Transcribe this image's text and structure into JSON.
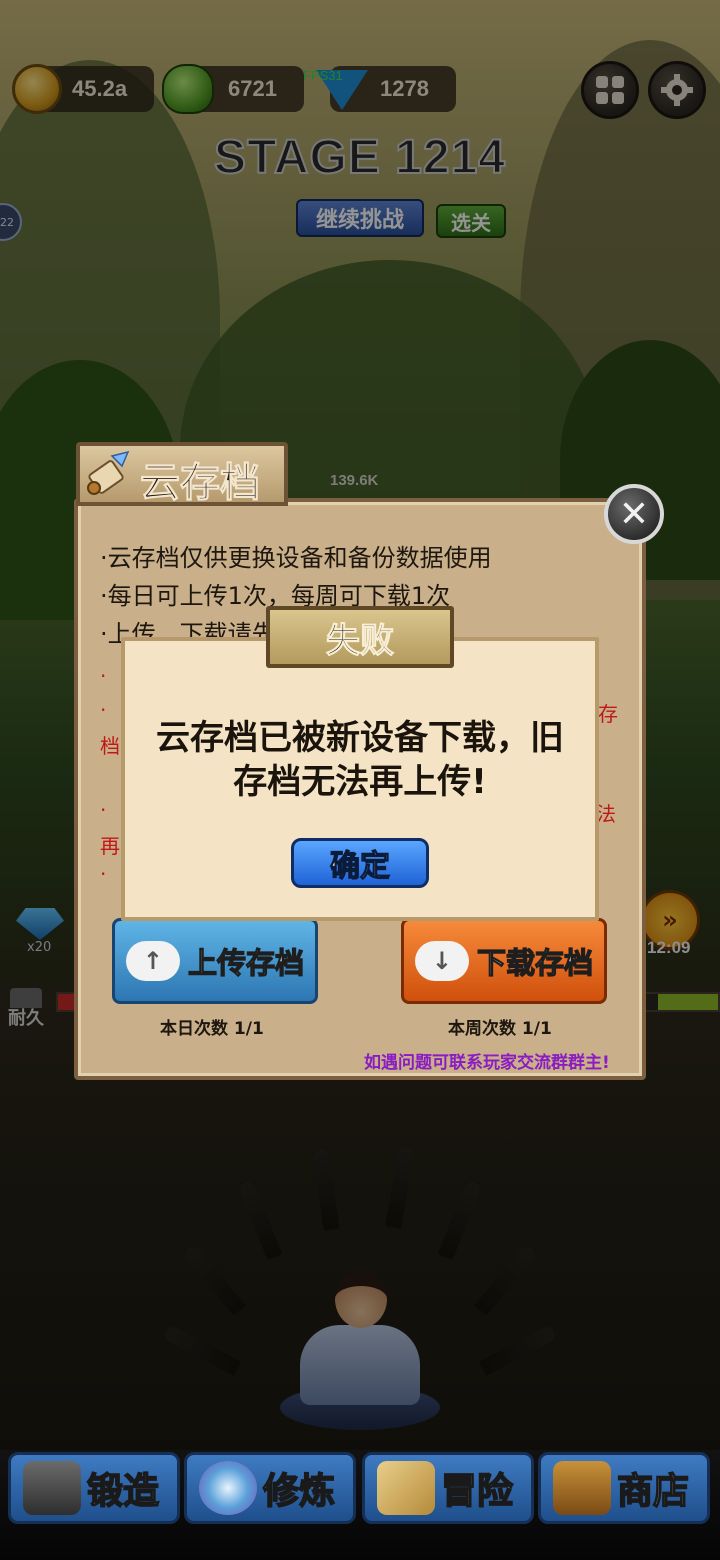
{
  "top_bar": {
    "gold": "45.2a",
    "slime": "6721",
    "fps": "FPS31",
    "gems": "1278"
  },
  "stage": {
    "title": "STAGE 1214",
    "continue_label": "继续挑战",
    "select_label": "选关"
  },
  "side_badge": "22",
  "dps_value": "139.6K",
  "left_gem_count": "x20",
  "timer": "12:09",
  "durable_label": "耐久",
  "cloud_save": {
    "title": "云存档",
    "rules": [
      "·云存档仅供更换设备和备份数据使用",
      "·每日可上传1次，每周可下载1次",
      "·上传、下载请先关闭游戏！"
    ],
    "red_notes": [
      "·",
      "·",
      "档",
      "·",
      "再",
      "·",
      "存",
      "法"
    ],
    "upload_label": "上传存档",
    "download_label": "下载存档",
    "daily_count": "本日次数 1/1",
    "weekly_count": "本周次数 1/1",
    "hint": "如遇问题可联系玩家交流群群主!"
  },
  "error_dialog": {
    "title": "失败",
    "message_line1": "云存档已被新设备下载，旧",
    "message_line2": "存档无法再上传!",
    "confirm_label": "确定"
  },
  "nav": [
    {
      "label": "锻造"
    },
    {
      "label": "修炼"
    },
    {
      "label": "冒险"
    },
    {
      "label": "商店"
    }
  ],
  "colors": {
    "panel": "#c9b08a",
    "popup": "#f4e3c4",
    "upload_btn": "#3d8fc9",
    "download_btn": "#e0641c",
    "confirm_btn": "#2f7de8",
    "hint_text": "#8a1cc2",
    "fps_text": "#3fe04a"
  }
}
